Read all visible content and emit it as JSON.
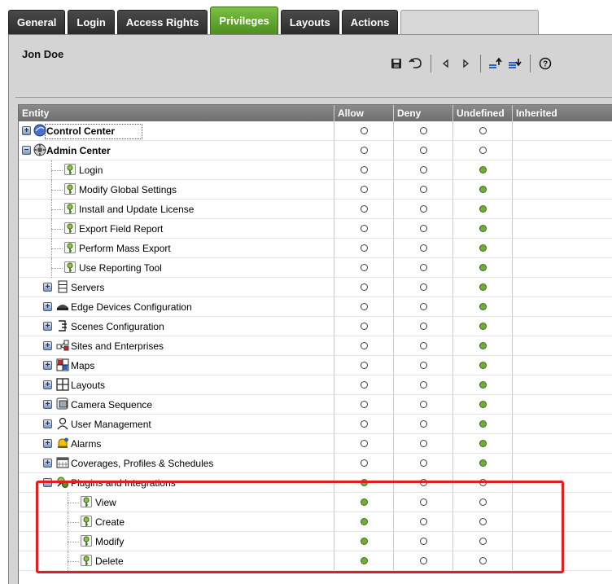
{
  "tabs": [
    {
      "label": "General",
      "active": false
    },
    {
      "label": "Login",
      "active": false
    },
    {
      "label": "Access Rights",
      "active": false
    },
    {
      "label": "Privileges",
      "active": true
    },
    {
      "label": "Layouts",
      "active": false
    },
    {
      "label": "Actions",
      "active": false
    }
  ],
  "user": {
    "name": "Jon Doe"
  },
  "toolbar": {
    "buttons": [
      "save-icon",
      "undo-icon",
      "previous-icon",
      "next-icon",
      "collapse-all-icon",
      "expand-all-icon",
      "help-icon"
    ]
  },
  "grid": {
    "columns": [
      "Entity",
      "Allow",
      "Deny",
      "Undefined",
      "Inherited"
    ],
    "rows": [
      {
        "label": "Control Center",
        "icon": "control-center-icon",
        "level": 0,
        "bold": true,
        "expander": "+",
        "allow": false,
        "deny": false,
        "undefined": false
      },
      {
        "label": "Admin Center",
        "icon": "admin-center-icon",
        "level": 0,
        "bold": true,
        "expander": "-",
        "allow": false,
        "deny": false,
        "undefined": false
      },
      {
        "label": "Login",
        "icon": "key-icon",
        "level": 1,
        "bold": false,
        "expander": "",
        "allow": false,
        "deny": false,
        "undefined": true
      },
      {
        "label": "Modify Global Settings",
        "icon": "key-icon",
        "level": 1,
        "bold": false,
        "expander": "",
        "allow": false,
        "deny": false,
        "undefined": true
      },
      {
        "label": "Install and Update License",
        "icon": "key-icon",
        "level": 1,
        "bold": false,
        "expander": "",
        "allow": false,
        "deny": false,
        "undefined": true
      },
      {
        "label": "Export Field Report",
        "icon": "key-icon",
        "level": 1,
        "bold": false,
        "expander": "",
        "allow": false,
        "deny": false,
        "undefined": true
      },
      {
        "label": "Perform Mass Export",
        "icon": "key-icon",
        "level": 1,
        "bold": false,
        "expander": "",
        "allow": false,
        "deny": false,
        "undefined": true
      },
      {
        "label": "Use Reporting Tool",
        "icon": "key-icon",
        "level": 1,
        "bold": false,
        "expander": "",
        "allow": false,
        "deny": false,
        "undefined": true
      },
      {
        "label": "Servers",
        "icon": "server-icon",
        "level": 1,
        "bold": false,
        "expander": "+",
        "allow": false,
        "deny": false,
        "undefined": true
      },
      {
        "label": "Edge Devices Configuration",
        "icon": "edge-device-icon",
        "level": 1,
        "bold": false,
        "expander": "+",
        "allow": false,
        "deny": false,
        "undefined": true
      },
      {
        "label": "Scenes Configuration",
        "icon": "scenes-icon",
        "level": 1,
        "bold": false,
        "expander": "+",
        "allow": false,
        "deny": false,
        "undefined": true
      },
      {
        "label": "Sites and Enterprises",
        "icon": "sites-icon",
        "level": 1,
        "bold": false,
        "expander": "+",
        "allow": false,
        "deny": false,
        "undefined": true
      },
      {
        "label": "Maps",
        "icon": "map-icon",
        "level": 1,
        "bold": false,
        "expander": "+",
        "allow": false,
        "deny": false,
        "undefined": true
      },
      {
        "label": "Layouts",
        "icon": "layout-icon",
        "level": 1,
        "bold": false,
        "expander": "+",
        "allow": false,
        "deny": false,
        "undefined": true
      },
      {
        "label": "Camera Sequence",
        "icon": "camera-sequence-icon",
        "level": 1,
        "bold": false,
        "expander": "+",
        "allow": false,
        "deny": false,
        "undefined": true
      },
      {
        "label": "User Management",
        "icon": "user-icon",
        "level": 1,
        "bold": false,
        "expander": "+",
        "allow": false,
        "deny": false,
        "undefined": true
      },
      {
        "label": "Alarms",
        "icon": "alarm-icon",
        "level": 1,
        "bold": false,
        "expander": "+",
        "allow": false,
        "deny": false,
        "undefined": true
      },
      {
        "label": "Coverages, Profiles & Schedules",
        "icon": "schedule-icon",
        "level": 1,
        "bold": false,
        "expander": "+",
        "allow": false,
        "deny": false,
        "undefined": true
      },
      {
        "label": "Plugins and Integrations",
        "icon": "plugin-icon",
        "level": 1,
        "bold": false,
        "expander": "-",
        "allow": true,
        "deny": false,
        "undefined": false
      },
      {
        "label": "View",
        "icon": "key-icon",
        "level": 2,
        "bold": false,
        "expander": "",
        "allow": true,
        "deny": false,
        "undefined": false
      },
      {
        "label": "Create",
        "icon": "key-icon",
        "level": 2,
        "bold": false,
        "expander": "",
        "allow": true,
        "deny": false,
        "undefined": false
      },
      {
        "label": "Modify",
        "icon": "key-icon",
        "level": 2,
        "bold": false,
        "expander": "",
        "allow": true,
        "deny": false,
        "undefined": false
      },
      {
        "label": "Delete",
        "icon": "key-icon",
        "level": 2,
        "bold": false,
        "expander": "",
        "allow": true,
        "deny": false,
        "undefined": false
      }
    ]
  },
  "colors": {
    "accent": "#6fae33",
    "highlight": "#e02020",
    "tab_active": "#5e9e2c",
    "tab_inactive": "#333333"
  }
}
